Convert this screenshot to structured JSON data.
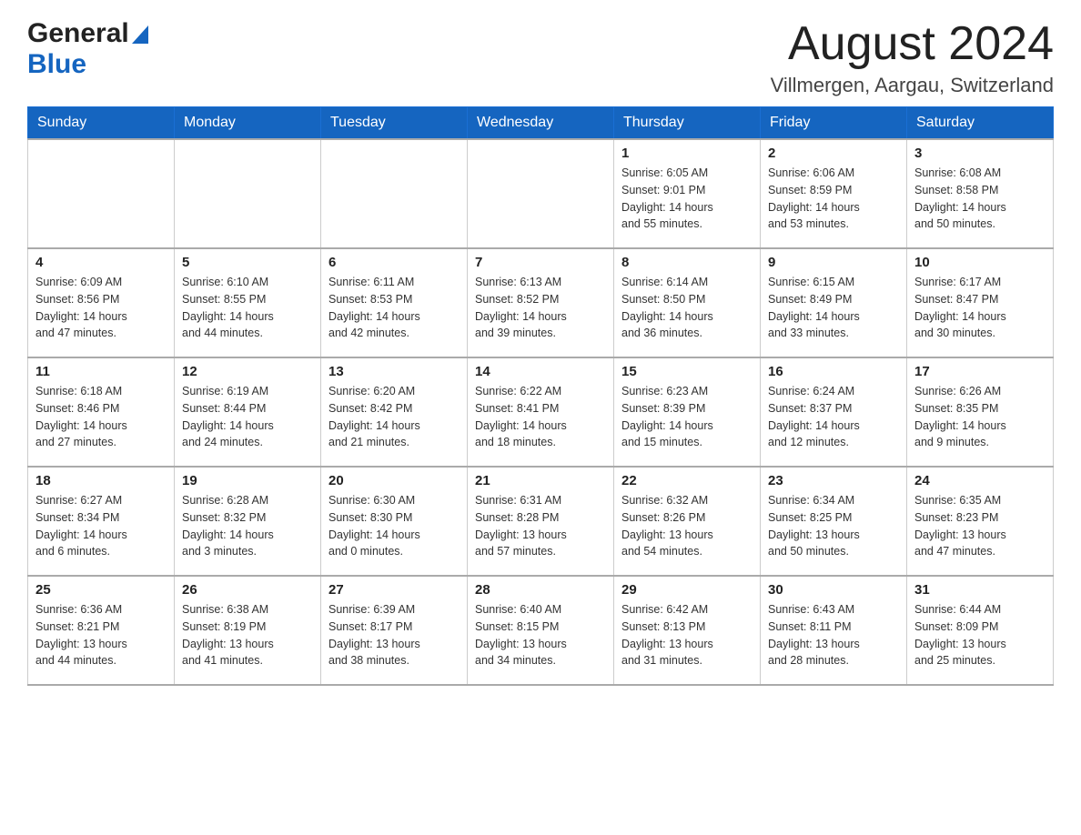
{
  "header": {
    "logo_general": "General",
    "logo_blue": "Blue",
    "month_title": "August 2024",
    "location": "Villmergen, Aargau, Switzerland"
  },
  "weekdays": [
    "Sunday",
    "Monday",
    "Tuesday",
    "Wednesday",
    "Thursday",
    "Friday",
    "Saturday"
  ],
  "weeks": [
    [
      {
        "day": "",
        "info": ""
      },
      {
        "day": "",
        "info": ""
      },
      {
        "day": "",
        "info": ""
      },
      {
        "day": "",
        "info": ""
      },
      {
        "day": "1",
        "info": "Sunrise: 6:05 AM\nSunset: 9:01 PM\nDaylight: 14 hours\nand 55 minutes."
      },
      {
        "day": "2",
        "info": "Sunrise: 6:06 AM\nSunset: 8:59 PM\nDaylight: 14 hours\nand 53 minutes."
      },
      {
        "day": "3",
        "info": "Sunrise: 6:08 AM\nSunset: 8:58 PM\nDaylight: 14 hours\nand 50 minutes."
      }
    ],
    [
      {
        "day": "4",
        "info": "Sunrise: 6:09 AM\nSunset: 8:56 PM\nDaylight: 14 hours\nand 47 minutes."
      },
      {
        "day": "5",
        "info": "Sunrise: 6:10 AM\nSunset: 8:55 PM\nDaylight: 14 hours\nand 44 minutes."
      },
      {
        "day": "6",
        "info": "Sunrise: 6:11 AM\nSunset: 8:53 PM\nDaylight: 14 hours\nand 42 minutes."
      },
      {
        "day": "7",
        "info": "Sunrise: 6:13 AM\nSunset: 8:52 PM\nDaylight: 14 hours\nand 39 minutes."
      },
      {
        "day": "8",
        "info": "Sunrise: 6:14 AM\nSunset: 8:50 PM\nDaylight: 14 hours\nand 36 minutes."
      },
      {
        "day": "9",
        "info": "Sunrise: 6:15 AM\nSunset: 8:49 PM\nDaylight: 14 hours\nand 33 minutes."
      },
      {
        "day": "10",
        "info": "Sunrise: 6:17 AM\nSunset: 8:47 PM\nDaylight: 14 hours\nand 30 minutes."
      }
    ],
    [
      {
        "day": "11",
        "info": "Sunrise: 6:18 AM\nSunset: 8:46 PM\nDaylight: 14 hours\nand 27 minutes."
      },
      {
        "day": "12",
        "info": "Sunrise: 6:19 AM\nSunset: 8:44 PM\nDaylight: 14 hours\nand 24 minutes."
      },
      {
        "day": "13",
        "info": "Sunrise: 6:20 AM\nSunset: 8:42 PM\nDaylight: 14 hours\nand 21 minutes."
      },
      {
        "day": "14",
        "info": "Sunrise: 6:22 AM\nSunset: 8:41 PM\nDaylight: 14 hours\nand 18 minutes."
      },
      {
        "day": "15",
        "info": "Sunrise: 6:23 AM\nSunset: 8:39 PM\nDaylight: 14 hours\nand 15 minutes."
      },
      {
        "day": "16",
        "info": "Sunrise: 6:24 AM\nSunset: 8:37 PM\nDaylight: 14 hours\nand 12 minutes."
      },
      {
        "day": "17",
        "info": "Sunrise: 6:26 AM\nSunset: 8:35 PM\nDaylight: 14 hours\nand 9 minutes."
      }
    ],
    [
      {
        "day": "18",
        "info": "Sunrise: 6:27 AM\nSunset: 8:34 PM\nDaylight: 14 hours\nand 6 minutes."
      },
      {
        "day": "19",
        "info": "Sunrise: 6:28 AM\nSunset: 8:32 PM\nDaylight: 14 hours\nand 3 minutes."
      },
      {
        "day": "20",
        "info": "Sunrise: 6:30 AM\nSunset: 8:30 PM\nDaylight: 14 hours\nand 0 minutes."
      },
      {
        "day": "21",
        "info": "Sunrise: 6:31 AM\nSunset: 8:28 PM\nDaylight: 13 hours\nand 57 minutes."
      },
      {
        "day": "22",
        "info": "Sunrise: 6:32 AM\nSunset: 8:26 PM\nDaylight: 13 hours\nand 54 minutes."
      },
      {
        "day": "23",
        "info": "Sunrise: 6:34 AM\nSunset: 8:25 PM\nDaylight: 13 hours\nand 50 minutes."
      },
      {
        "day": "24",
        "info": "Sunrise: 6:35 AM\nSunset: 8:23 PM\nDaylight: 13 hours\nand 47 minutes."
      }
    ],
    [
      {
        "day": "25",
        "info": "Sunrise: 6:36 AM\nSunset: 8:21 PM\nDaylight: 13 hours\nand 44 minutes."
      },
      {
        "day": "26",
        "info": "Sunrise: 6:38 AM\nSunset: 8:19 PM\nDaylight: 13 hours\nand 41 minutes."
      },
      {
        "day": "27",
        "info": "Sunrise: 6:39 AM\nSunset: 8:17 PM\nDaylight: 13 hours\nand 38 minutes."
      },
      {
        "day": "28",
        "info": "Sunrise: 6:40 AM\nSunset: 8:15 PM\nDaylight: 13 hours\nand 34 minutes."
      },
      {
        "day": "29",
        "info": "Sunrise: 6:42 AM\nSunset: 8:13 PM\nDaylight: 13 hours\nand 31 minutes."
      },
      {
        "day": "30",
        "info": "Sunrise: 6:43 AM\nSunset: 8:11 PM\nDaylight: 13 hours\nand 28 minutes."
      },
      {
        "day": "31",
        "info": "Sunrise: 6:44 AM\nSunset: 8:09 PM\nDaylight: 13 hours\nand 25 minutes."
      }
    ]
  ]
}
